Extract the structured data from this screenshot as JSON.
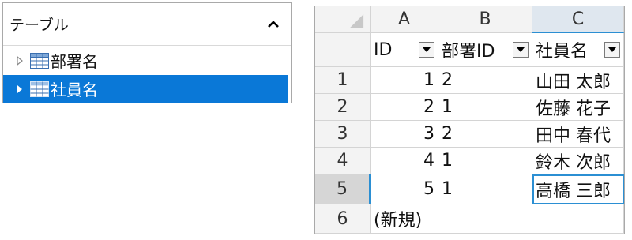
{
  "tree": {
    "header": "テーブル",
    "items": [
      {
        "label": "部署名",
        "selected": false
      },
      {
        "label": "社員名",
        "selected": true
      }
    ]
  },
  "grid": {
    "columns": [
      "A",
      "B",
      "C"
    ],
    "fields": [
      "ID",
      "部署ID",
      "社員名"
    ],
    "rows": [
      {
        "num": "1",
        "id": "1",
        "dept": "2",
        "name": "山田 太郎"
      },
      {
        "num": "2",
        "id": "2",
        "dept": "1",
        "name": "佐藤 花子"
      },
      {
        "num": "3",
        "id": "3",
        "dept": "2",
        "name": "田中 春代"
      },
      {
        "num": "4",
        "id": "4",
        "dept": "1",
        "name": "鈴木 次郎"
      },
      {
        "num": "5",
        "id": "5",
        "dept": "1",
        "name": "高橋 三郎"
      },
      {
        "num": "6",
        "id": "(新規)",
        "dept": "",
        "name": ""
      }
    ]
  },
  "colors": {
    "selection": "#0a78d7",
    "accent": "#2b8fd3"
  }
}
